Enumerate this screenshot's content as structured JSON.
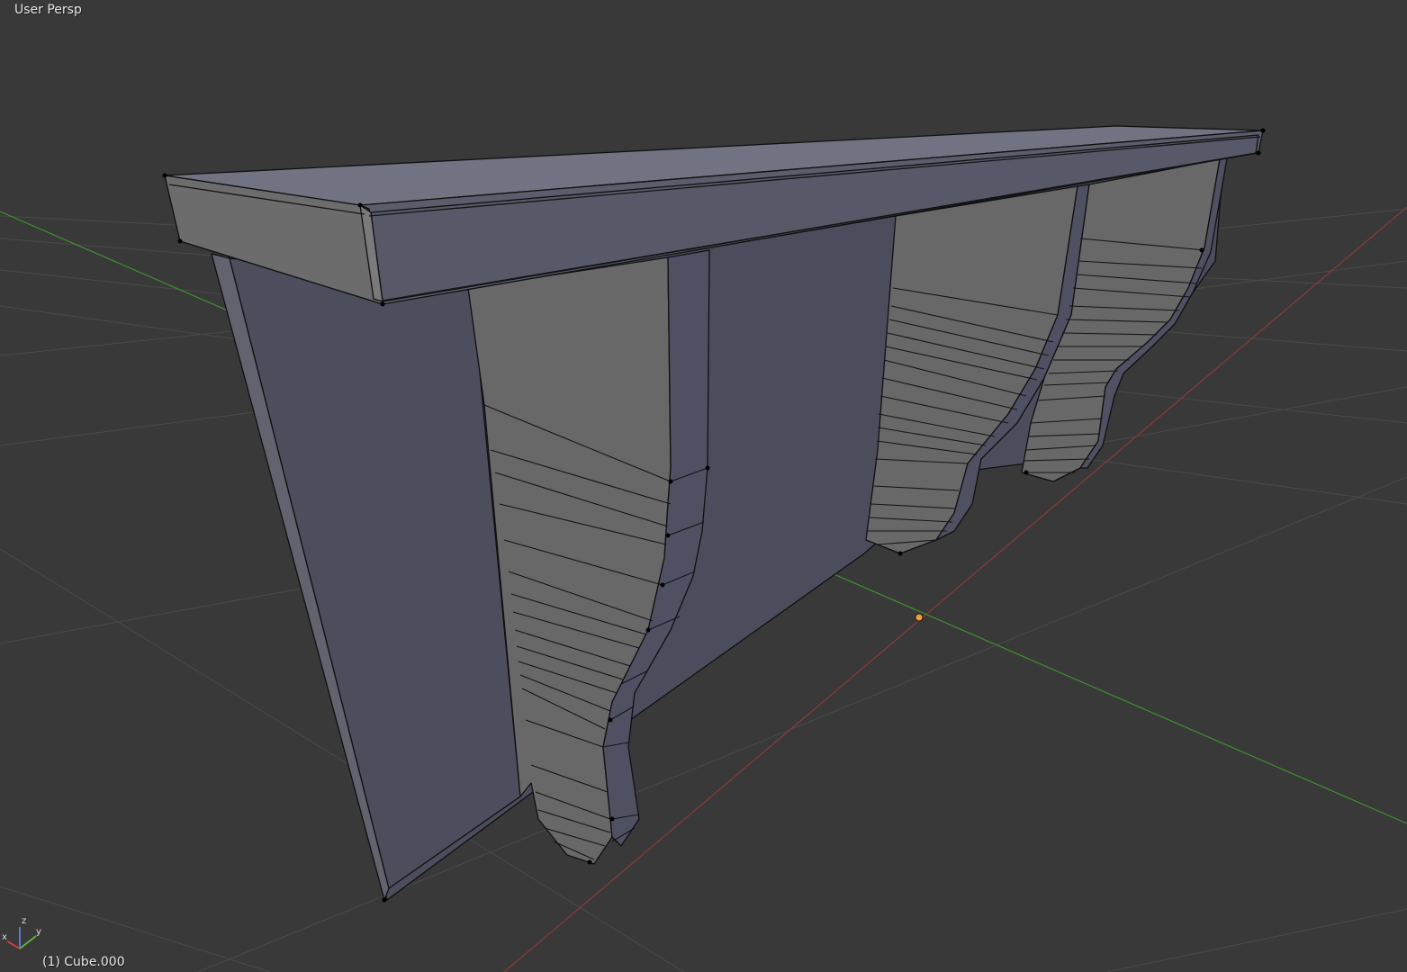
{
  "viewport": {
    "view_label": "User Persp",
    "object_label": "(1) Cube.000",
    "colors": {
      "background": "#393939",
      "grid": "#4a4a4a",
      "x_axis": "#8a3a3a",
      "y_axis": "#3f8f2f",
      "face_light": "#6f7080",
      "face_mid": "#5c5d6b",
      "face_dark": "#4c4e5e",
      "face_gray": "#696969",
      "wire": "#101010",
      "origin": "#f0a040"
    }
  },
  "gizmo": {
    "x_label": "x",
    "y_label": "y",
    "z_label": "z"
  }
}
